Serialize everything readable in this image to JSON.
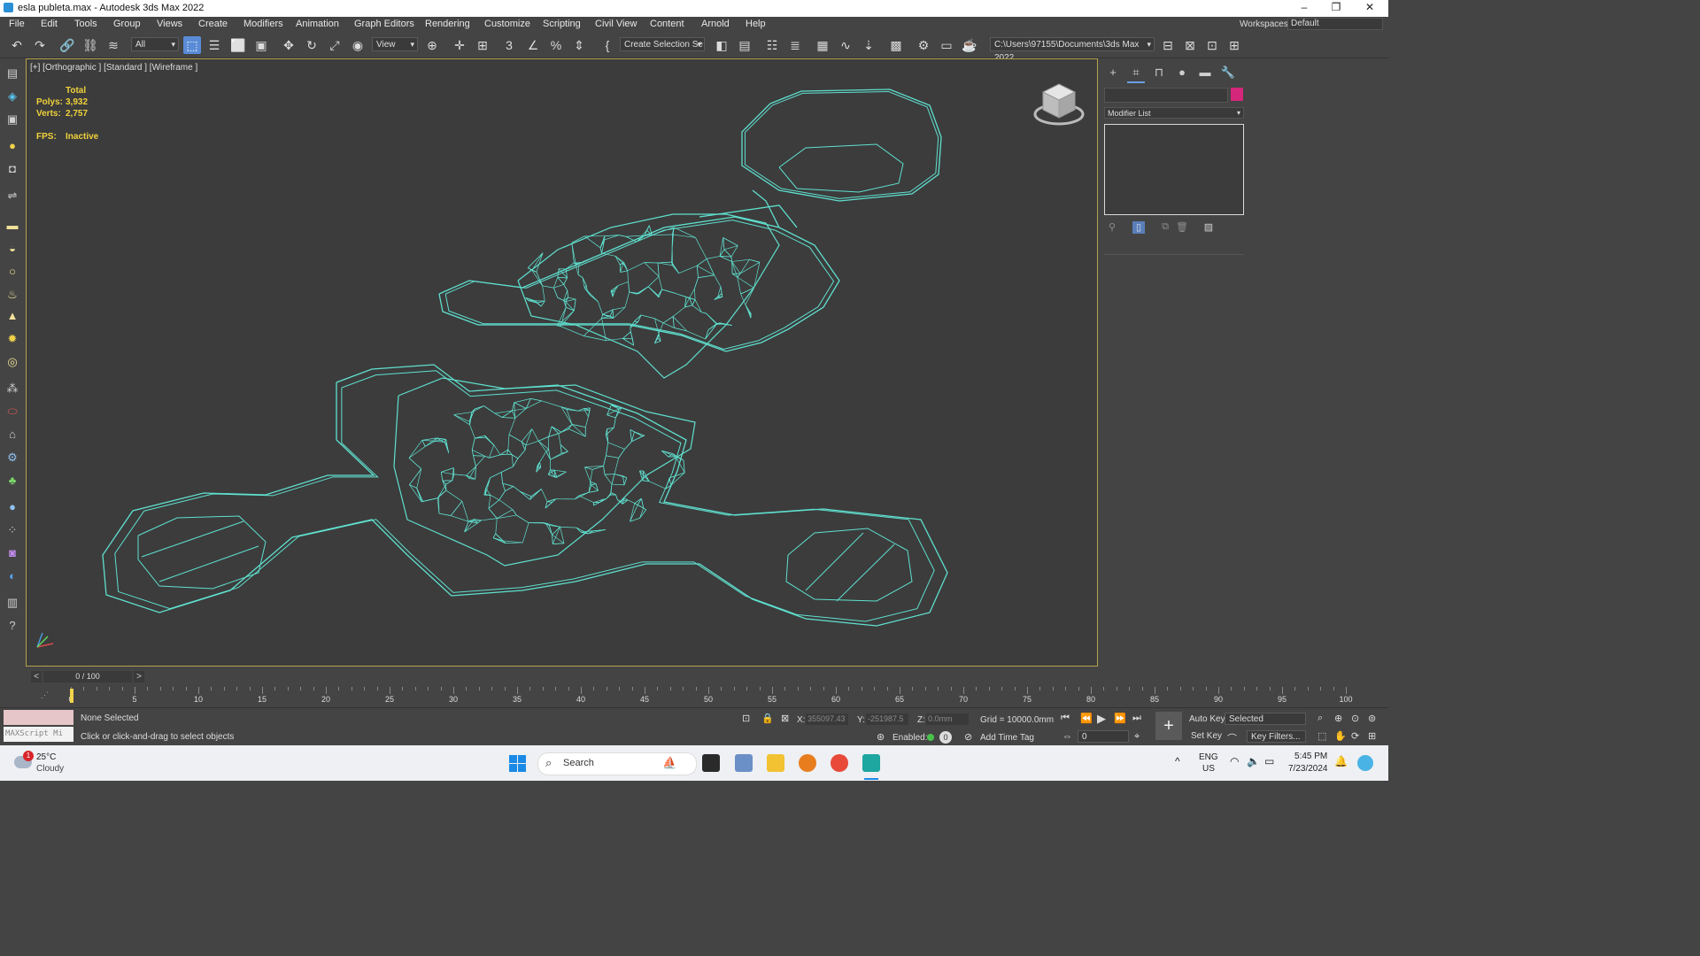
{
  "window": {
    "title": "esla publeta.max - Autodesk 3ds Max 2022",
    "minimize": "–",
    "maximize": "❐",
    "close": "✕"
  },
  "menu": [
    "File",
    "Edit",
    "Tools",
    "Group",
    "Views",
    "Create",
    "Modifiers",
    "Animation",
    "Graph Editors",
    "Rendering",
    "Customize",
    "Scripting",
    "Civil View",
    "Content",
    "Arnold",
    "Help"
  ],
  "workspaces": {
    "label": "Workspaces:",
    "value": "Default"
  },
  "toolbar": {
    "selection_filter": "All",
    "ref_coord": "View",
    "named_selection": "Create Selection Se",
    "project_path": "C:\\Users\\97155\\Documents\\3ds Max 2022"
  },
  "viewport": {
    "label": "[+] [Orthographic ] [Standard ] [Wireframe ]",
    "stats": {
      "total_label": "Total",
      "polys_label": "Polys:",
      "polys": "3,932",
      "verts_label": "Verts:",
      "verts": "2,757",
      "fps_label": "FPS:",
      "fps": "Inactive"
    },
    "wire_color": "#5fe0cf"
  },
  "command_panel": {
    "modifier_list": "Modifier List",
    "object_color": "#d4267a"
  },
  "time_slider": {
    "frame": "0 / 100",
    "prev": "<",
    "next": ">"
  },
  "track_ticks": [
    "0",
    "5",
    "10",
    "15",
    "20",
    "25",
    "30",
    "35",
    "40",
    "45",
    "50",
    "55",
    "60",
    "65",
    "70",
    "75",
    "80",
    "85",
    "90",
    "95",
    "100"
  ],
  "status": {
    "maxscript": "MAXScript Mi",
    "selection": "None Selected",
    "prompt": "Click or click-and-drag to select objects",
    "x_label": "X:",
    "x": "355097.43",
    "y_label": "Y:",
    "y": "-251987.5",
    "z_label": "Z:",
    "z": "0.0mm",
    "grid": "Grid = 10000.0mm",
    "enabled_label": "Enabled:",
    "add_time_tag": "Add Time Tag",
    "auto_key": "Auto Key",
    "set_key": "Set Key",
    "key_mode": "Selected",
    "key_filters": "Key Filters...",
    "current_frame": "0"
  },
  "taskbar": {
    "weather_temp": "25°C",
    "weather_desc": "Cloudy",
    "weather_badge": "1",
    "search": "Search",
    "lang": "ENG",
    "region": "US",
    "time": "5:45 PM",
    "date": "7/23/2024"
  }
}
